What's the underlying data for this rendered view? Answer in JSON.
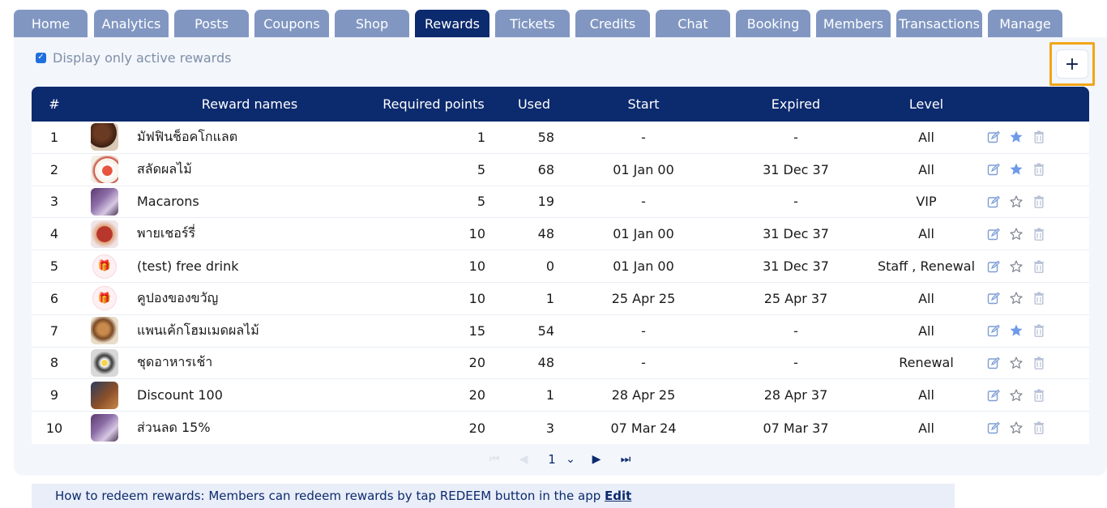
{
  "tabs": [
    {
      "label": "Home"
    },
    {
      "label": "Analytics"
    },
    {
      "label": "Posts"
    },
    {
      "label": "Coupons"
    },
    {
      "label": "Shop"
    },
    {
      "label": "Rewards"
    },
    {
      "label": "Tickets"
    },
    {
      "label": "Credits"
    },
    {
      "label": "Chat"
    },
    {
      "label": "Booking"
    },
    {
      "label": "Members"
    },
    {
      "label": "Transactions"
    },
    {
      "label": "Manage"
    }
  ],
  "active_tab": "Rewards",
  "filter": {
    "label": "Display only active rewards",
    "checked": true
  },
  "add_button": {
    "label": "+"
  },
  "table": {
    "headers": [
      "#",
      "Reward names",
      "Required points",
      "Used",
      "Start",
      "Expired",
      "Level"
    ],
    "rows": [
      {
        "num": "1",
        "image": "muffin-photo",
        "name": "มัฟฟินช็อคโกแลต",
        "required": "1",
        "used": "58",
        "start": "-",
        "expired": "-",
        "level": "All",
        "starred": true
      },
      {
        "num": "2",
        "image": "fruit-salad-photo",
        "name": "สลัดผลไม้",
        "required": "5",
        "used": "68",
        "start": "01 Jan 00",
        "expired": "31 Dec 37",
        "level": "All",
        "starred": true
      },
      {
        "num": "3",
        "image": "macarons-photo",
        "name": "Macarons",
        "required": "5",
        "used": "19",
        "start": "-",
        "expired": "-",
        "level": "VIP",
        "starred": false
      },
      {
        "num": "4",
        "image": "cherry-pie-photo",
        "name": "พายเชอร์รี่",
        "required": "10",
        "used": "48",
        "start": "01 Jan 00",
        "expired": "31 Dec 37",
        "level": "All",
        "starred": false
      },
      {
        "num": "5",
        "image": "gift-icon",
        "name": "(test) free drink",
        "required": "10",
        "used": "0",
        "start": "01 Jan 00",
        "expired": "31 Dec 37",
        "level": "Staff , Renewal",
        "starred": false
      },
      {
        "num": "6",
        "image": "gift-icon",
        "name": "คูปองของขวัญ",
        "required": "10",
        "used": "1",
        "start": "25 Apr 25",
        "expired": "25 Apr 37",
        "level": "All",
        "starred": false
      },
      {
        "num": "7",
        "image": "pancake-photo",
        "name": "แพนเค้กโฮมเมดผลไม้",
        "required": "15",
        "used": "54",
        "start": "-",
        "expired": "-",
        "level": "All",
        "starred": true
      },
      {
        "num": "8",
        "image": "breakfast-photo",
        "name": "ชุดอาหารเช้า",
        "required": "20",
        "used": "48",
        "start": "-",
        "expired": "-",
        "level": "Renewal",
        "starred": false
      },
      {
        "num": "9",
        "image": "discount-card-photo",
        "name": "Discount 100",
        "required": "20",
        "used": "1",
        "start": "28 Apr 25",
        "expired": "28 Apr 37",
        "level": "All",
        "starred": false
      },
      {
        "num": "10",
        "image": "macarons-photo",
        "name": "ส่วนลด 15%",
        "required": "20",
        "used": "3",
        "start": "07 Mar 24",
        "expired": "07 Mar 37",
        "level": "All",
        "starred": false
      }
    ]
  },
  "pagination": {
    "page": "1"
  },
  "note": {
    "text": "How to redeem rewards: Members can redeem rewards by tap REDEEM button in the app",
    "link": "Edit"
  },
  "colors": {
    "accent": "#0c2a6e",
    "tab": "#8197c2",
    "highlight": "#f2a51a",
    "star": "#6f9ae8"
  }
}
